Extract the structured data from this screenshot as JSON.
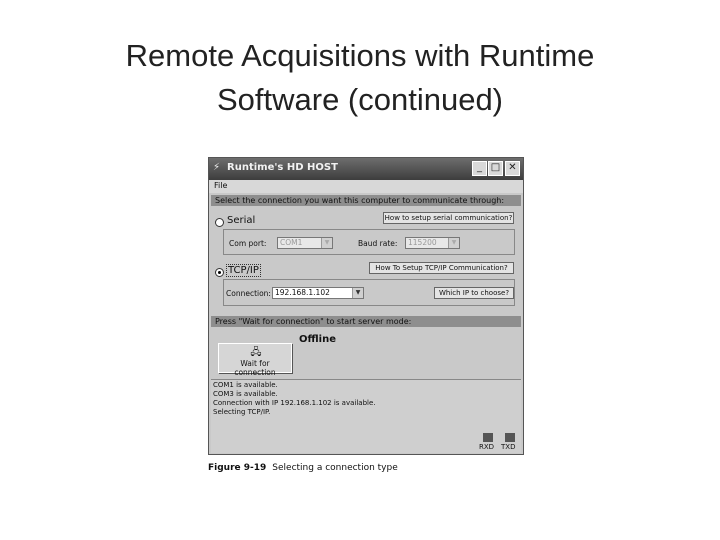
{
  "slide": {
    "title": "Remote Acquisitions with Runtime\nSoftware (continued)"
  },
  "window": {
    "title": "Runtime's HD HOST",
    "controls": {
      "minimize": "_",
      "maximize": "□",
      "close": "✕"
    },
    "menu": {
      "file": "File"
    },
    "connection_header": "Select the connection you want this computer to communicate through:",
    "serial": {
      "label": "Serial",
      "selected": false,
      "help_button": "How to setup serial communication?",
      "com_port_label": "Com port:",
      "com_port_value": "COM1",
      "baud_rate_label": "Baud rate:",
      "baud_rate_value": "115200"
    },
    "tcpip": {
      "label": "TCP/IP",
      "selected": true,
      "help_button": "How To Setup TCP/IP Communication?",
      "connection_label": "Connection:",
      "connection_value": "192.168.1.102",
      "which_ip_button": "Which IP to choose?"
    },
    "server_header": "Press \"Wait for connection\" to start server mode:",
    "wait_button": "Wait for connection",
    "status": "Offline",
    "log": [
      "COM1 is available.",
      "COM3 is available.",
      "Connection with IP 192.168.1.102 is available.",
      "Selecting TCP/IP."
    ],
    "indicators": {
      "rxd": "RXD",
      "txd": "TXD"
    }
  },
  "caption": {
    "figure": "Figure 9-19",
    "text": "Selecting a connection type"
  }
}
